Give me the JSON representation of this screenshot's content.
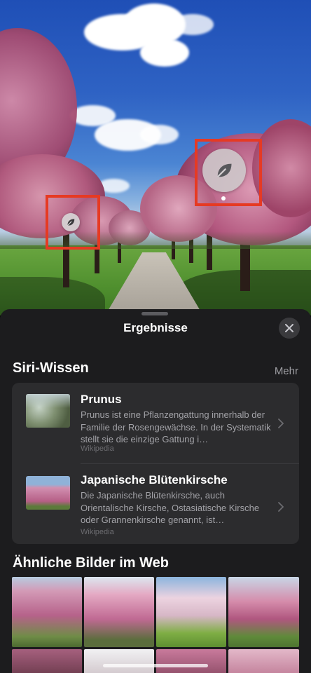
{
  "sheet": {
    "title": "Ergebnisse",
    "close_icon": "close-icon"
  },
  "siri_knowledge": {
    "heading": "Siri-Wissen",
    "more_label": "Mehr",
    "items": [
      {
        "title": "Prunus",
        "description": "Prunus ist eine Pflanzengattung innerhalb der Familie der Rosengewächse. In der Systematik stellt sie die einzige Gattung i…",
        "source": "Wikipedia"
      },
      {
        "title": "Japanische Blütenkirsche",
        "description": "Die Japanische Blütenkirsche, auch Orientalische Kirsche, Ostasiatische Kirsche oder Grannenkirsche genannt, ist…",
        "source": "Wikipedia"
      }
    ]
  },
  "similar_images": {
    "heading": "Ähnliche Bilder im Web"
  },
  "photo": {
    "marker_icon": "leaf-icon",
    "highlight_color": "#e63a23"
  }
}
